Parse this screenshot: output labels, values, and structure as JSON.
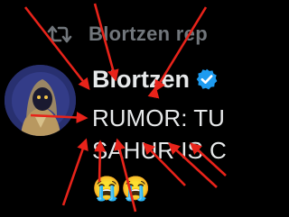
{
  "repost": {
    "icon": "repost-icon",
    "text": "Blortzen rep"
  },
  "author": {
    "display_name": "Blortzen",
    "verified_icon": "verified-badge-icon",
    "verified_color": "#1d9bf0"
  },
  "tweet": {
    "line1": "RUMOR: TU",
    "line2": "SAHUR IS C"
  },
  "emojis": "😭😭",
  "colors": {
    "background": "#000000",
    "arrow": "#e8231a",
    "muted": "#71767b",
    "text": "#e7e9ea"
  }
}
